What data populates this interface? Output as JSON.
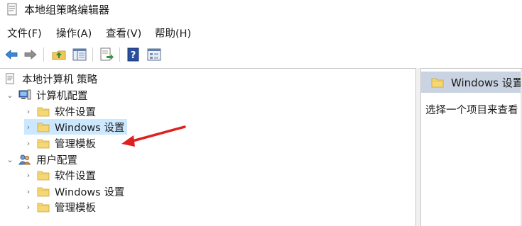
{
  "window": {
    "title": "本地组策略编辑器"
  },
  "menu": [
    {
      "label": "文件(F)"
    },
    {
      "label": "操作(A)"
    },
    {
      "label": "查看(V)"
    },
    {
      "label": "帮助(H)"
    }
  ],
  "toolbar": {
    "buttons": [
      "back-arrow-icon",
      "forward-arrow-icon",
      "up-folder-icon",
      "show-hide-tree-icon",
      "export-list-icon",
      "help-icon",
      "properties-icon"
    ]
  },
  "tree": {
    "root": {
      "label": "本地计算机 策略"
    },
    "computer_config": {
      "label": "计算机配置",
      "children": [
        {
          "label": "软件设置"
        },
        {
          "label": "Windows 设置"
        },
        {
          "label": "管理模板"
        }
      ]
    },
    "user_config": {
      "label": "用户配置",
      "children": [
        {
          "label": "软件设置"
        },
        {
          "label": "Windows 设置"
        },
        {
          "label": "管理模板"
        }
      ]
    }
  },
  "details": {
    "header": "Windows 设置",
    "description": "选择一个项目来查看"
  },
  "colors": {
    "selection": "#cce8ff",
    "header_bg": "#c9d3e2",
    "annotation_arrow": "#e0201f",
    "folder": "#f5d774"
  }
}
